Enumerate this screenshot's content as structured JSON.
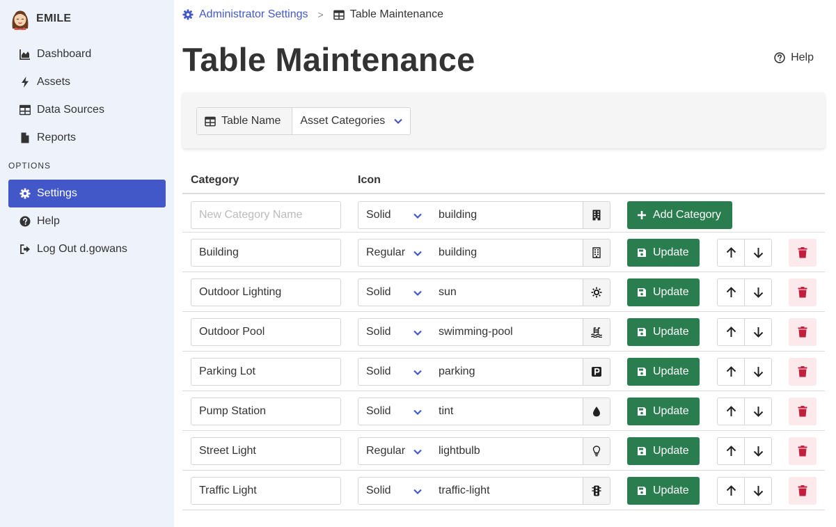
{
  "brand": {
    "name": "EMILE"
  },
  "sidebar": {
    "items": [
      {
        "label": "Dashboard",
        "icon": "chart-area-icon"
      },
      {
        "label": "Assets",
        "icon": "bolt-icon"
      },
      {
        "label": "Data Sources",
        "icon": "table-icon"
      },
      {
        "label": "Reports",
        "icon": "file-icon"
      }
    ],
    "options_label": "OPTIONS",
    "options": [
      {
        "label": "Settings",
        "icon": "gear-icon",
        "active": true
      },
      {
        "label": "Help",
        "icon": "question-circle-icon"
      },
      {
        "label": "Log Out d.gowans",
        "icon": "sign-out-icon"
      }
    ]
  },
  "breadcrumb": {
    "parent": "Administrator Settings",
    "separator": ">",
    "current": "Table Maintenance"
  },
  "page": {
    "title": "Table Maintenance",
    "help_label": "Help"
  },
  "selector": {
    "label": "Table Name",
    "value": "Asset Categories"
  },
  "table": {
    "headers": {
      "category": "Category",
      "icon": "Icon"
    },
    "new_row": {
      "placeholder": "New Category Name",
      "style": "Solid",
      "icon": "building",
      "add_label": "Add Category"
    },
    "update_label": "Update",
    "rows": [
      {
        "category": "Building",
        "style": "Regular",
        "icon": "building"
      },
      {
        "category": "Outdoor Lighting",
        "style": "Solid",
        "icon": "sun"
      },
      {
        "category": "Outdoor Pool",
        "style": "Solid",
        "icon": "swimming-pool"
      },
      {
        "category": "Parking Lot",
        "style": "Solid",
        "icon": "parking"
      },
      {
        "category": "Pump Station",
        "style": "Solid",
        "icon": "tint"
      },
      {
        "category": "Street Light",
        "style": "Regular",
        "icon": "lightbulb"
      },
      {
        "category": "Traffic Light",
        "style": "Solid",
        "icon": "traffic-light"
      }
    ]
  },
  "colors": {
    "accent": "#4258c9",
    "success": "#2a7d4f",
    "danger": "#c0203b",
    "danger_bg": "#fbe9ec",
    "sidebar_bg": "#eef3fb"
  }
}
